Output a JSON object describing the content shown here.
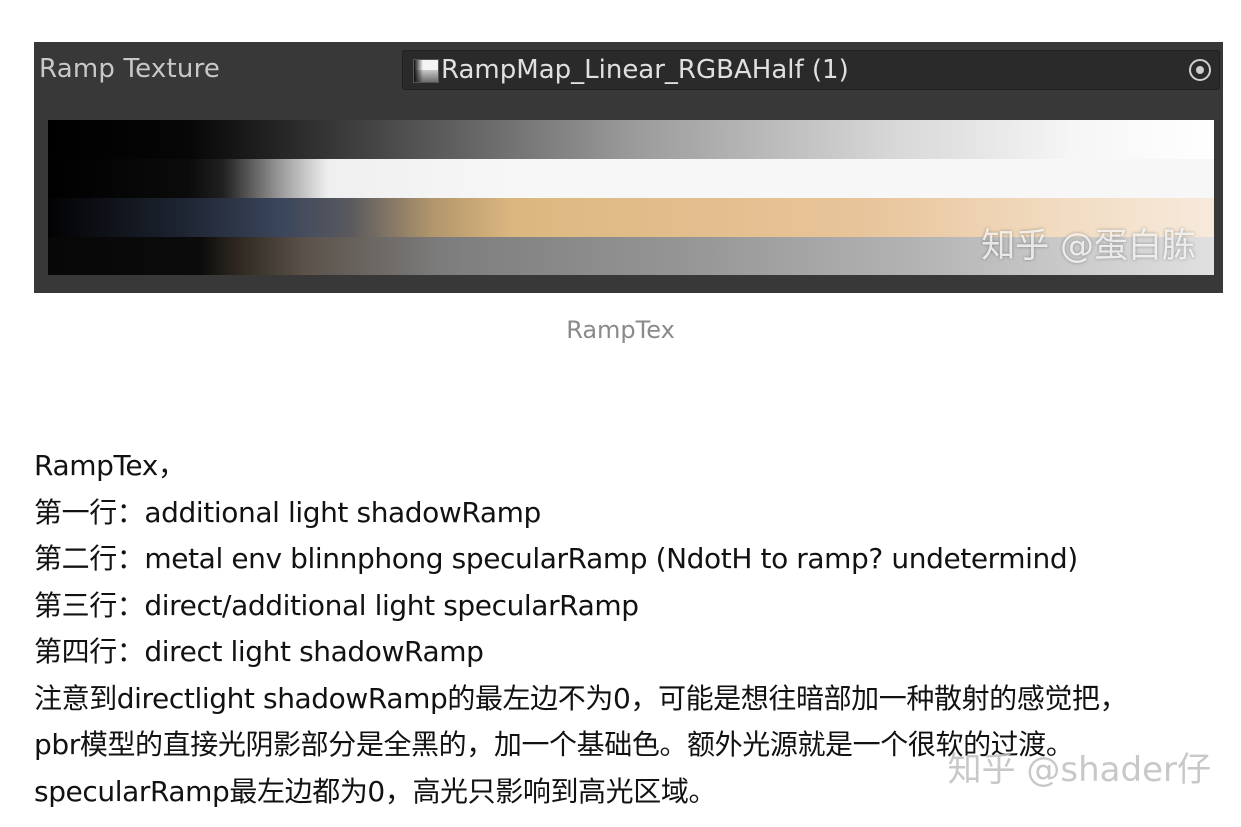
{
  "inspector": {
    "field_label": "Ramp Texture",
    "object_field_value": "RampMap_Linear_RGBAHalf (1)",
    "icon": "texture-icon",
    "picker_icon": "object-picker-icon",
    "preview_watermark": "知乎 @蛋白胨"
  },
  "caption": "RampTex",
  "body": {
    "lines": [
      "RampTex，",
      "第一行：additional light shadowRamp",
      "第二行：metal env blinnphong specularRamp (NdotH to ramp? undetermind)",
      "第三行：direct/additional light specularRamp",
      "第四行：direct light shadowRamp",
      "注意到directlight shadowRamp的最左边不为0，可能是想往暗部加一种散射的感觉把，",
      "pbr模型的直接光阴影部分是全黑的，加一个基础色。额外光源就是一个很软的过渡。",
      "specularRamp最左边都为0，高光只影响到高光区域。"
    ]
  },
  "page_watermark": "知乎 @shader仔",
  "colors": {
    "inspector_bg": "#383838",
    "field_bg": "#2a2a2a",
    "text_light": "#c8c8c8",
    "caption": "#8a8a8a",
    "body_text": "#121212"
  }
}
